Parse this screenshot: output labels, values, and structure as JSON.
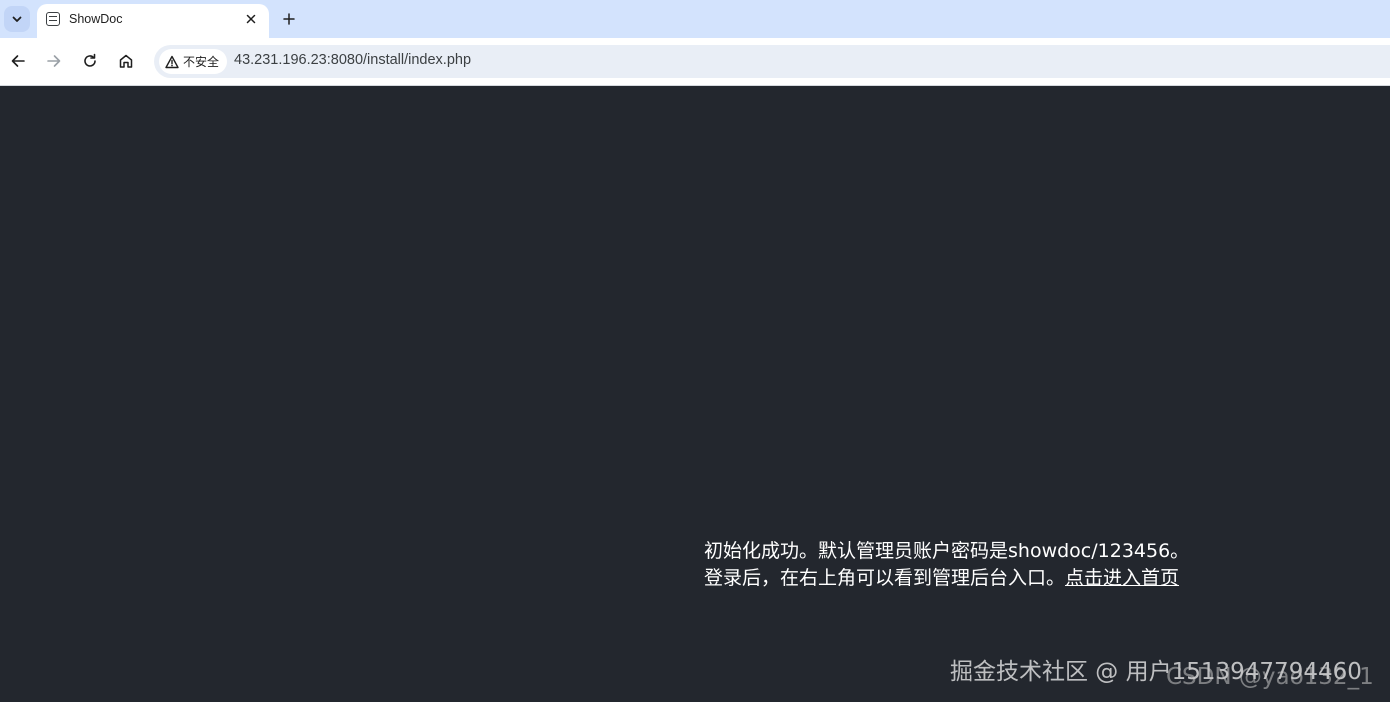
{
  "browser": {
    "tab": {
      "title": "ShowDoc",
      "favicon": "document-icon"
    },
    "toolbar": {
      "security_label": "不安全",
      "url": "43.231.196.23:8080/install/index.php"
    }
  },
  "page": {
    "message_line1": "初始化成功。默认管理员账户密码是showdoc/123456。",
    "message_line2_prefix": "登录后，在右上角可以看到管理后台入口。",
    "home_link": "点击进入首页",
    "background_color": "#23272e"
  },
  "watermarks": {
    "juejin": "掘金技术社区 @ 用户1513947794460",
    "csdn": "CSDN @yao132_1"
  }
}
